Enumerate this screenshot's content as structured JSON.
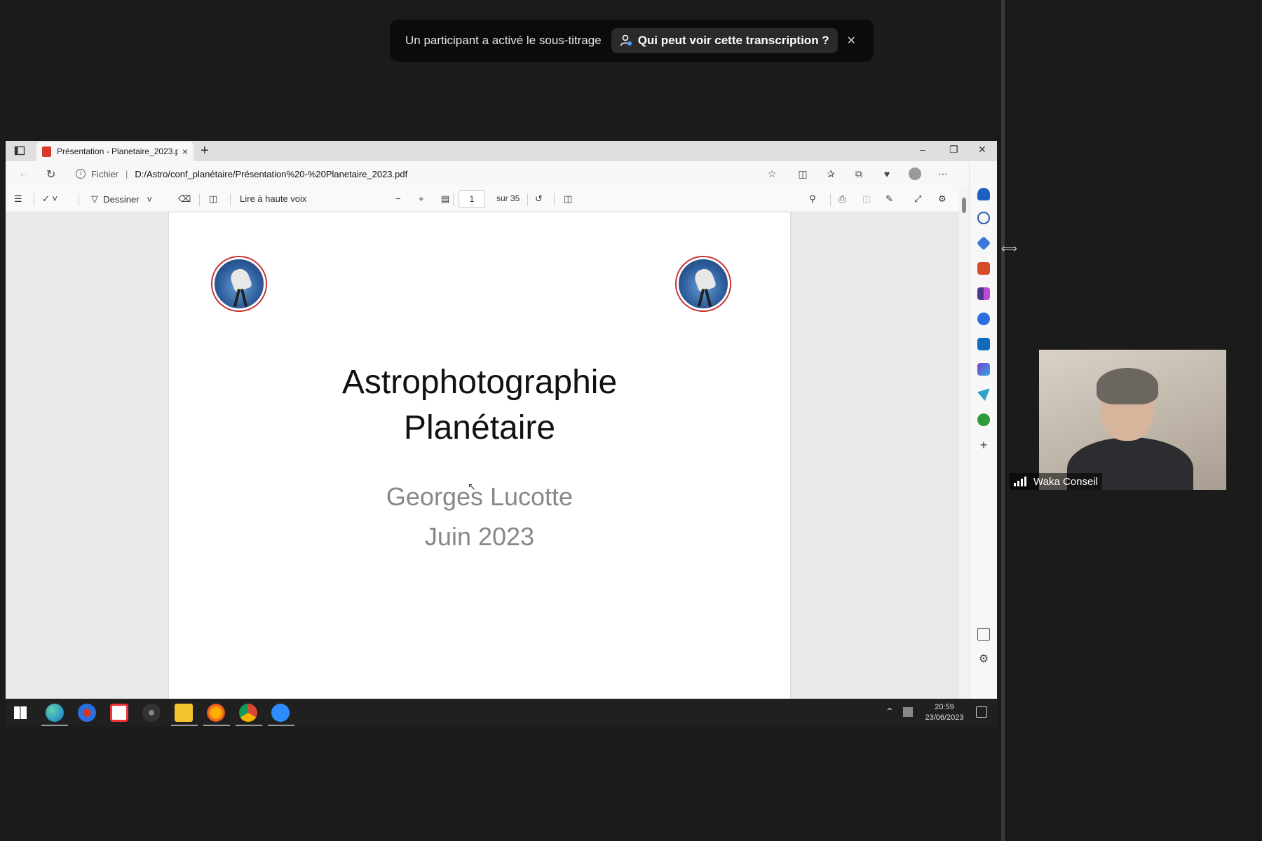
{
  "banner": {
    "message": "Un participant a activé le sous-titrage",
    "link_label": "Qui peut voir cette transcription ?",
    "close": "×"
  },
  "browser": {
    "tab_title": "Présentation - Planetaire_2023.p",
    "tab_close": "×",
    "new_tab": "+",
    "url_scheme": "Fichier",
    "url_path": "D:/Astro/conf_planétaire/Présentation%20-%20Planetaire_2023.pdf"
  },
  "pdf_toolbar": {
    "draw_label": "Dessiner",
    "read_aloud_label": "Lire à haute voix",
    "page_current": "1",
    "page_total": "sur 35"
  },
  "slide": {
    "title_line1": "Astrophotographie",
    "title_line2": "Planétaire",
    "author": "Georges Lucotte",
    "date": "Juin 2023"
  },
  "taskbar": {
    "time": "20:59",
    "date": "23/06/2023"
  },
  "participant": {
    "name": "Waka Conseil"
  },
  "colors": {
    "background": "#1b1b1b",
    "accent_blue": "#0f6cbd",
    "pdf_red": "#d93a2b"
  }
}
